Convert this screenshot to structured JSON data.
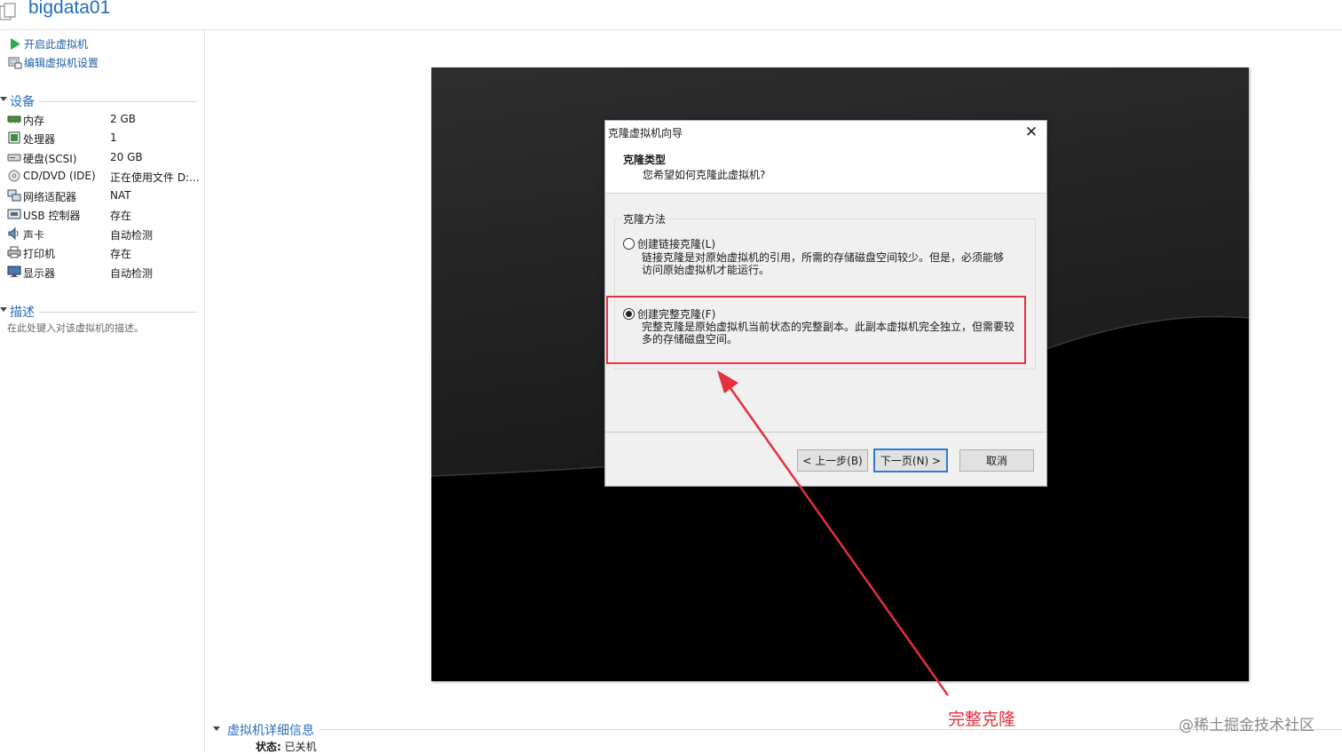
{
  "header": {
    "vm_name": "bigdata01"
  },
  "actions": {
    "power_on": "开启此虚拟机",
    "edit_settings": "编辑虚拟机设置"
  },
  "devices_section": {
    "title": "设备",
    "items": [
      {
        "icon": "memory-icon",
        "name": "内存",
        "value": "2 GB"
      },
      {
        "icon": "processor-icon",
        "name": "处理器",
        "value": "1"
      },
      {
        "icon": "hard-disk-icon",
        "name": "硬盘(SCSI)",
        "value": "20 GB"
      },
      {
        "icon": "cd-dvd-icon",
        "name": "CD/DVD (IDE)",
        "value": "正在使用文件 D:..."
      },
      {
        "icon": "network-adapter-icon",
        "name": "网络适配器",
        "value": "NAT"
      },
      {
        "icon": "usb-icon",
        "name": "USB 控制器",
        "value": "存在"
      },
      {
        "icon": "sound-card-icon",
        "name": "声卡",
        "value": "自动检测"
      },
      {
        "icon": "printer-icon",
        "name": "打印机",
        "value": "存在"
      },
      {
        "icon": "display-icon",
        "name": "显示器",
        "value": "自动检测"
      }
    ]
  },
  "description_section": {
    "title": "描述",
    "placeholder": "在此处键入对该虚拟机的描述。"
  },
  "dialog": {
    "title": "克隆虚拟机向导",
    "heading": "克隆类型",
    "subheading": "您希望如何克隆此虚拟机?",
    "group_label": "克隆方法",
    "options": [
      {
        "label": "创建链接克隆(L)",
        "desc_line1": "链接克隆是对原始虚拟机的引用，所需的存储磁盘空间较少。但是，必须能够",
        "desc_line2": "访问原始虚拟机才能运行。",
        "checked": false
      },
      {
        "label": "创建完整克隆(F)",
        "desc_line1": "完整克隆是原始虚拟机当前状态的完整副本。此副本虚拟机完全独立，但需要较",
        "desc_line2": "多的存储磁盘空间。",
        "checked": true
      }
    ],
    "buttons": {
      "back": "< 上一步(B)",
      "next": "下一页(N) >",
      "cancel": "取消"
    },
    "close_icon": "close-icon"
  },
  "annotation": {
    "text": "完整克隆",
    "color": "#e5303d"
  },
  "details": {
    "title": "虚拟机详细信息",
    "status_key": "状态:",
    "status_value": "已关机"
  },
  "watermark": "@稀土掘金技术社区"
}
